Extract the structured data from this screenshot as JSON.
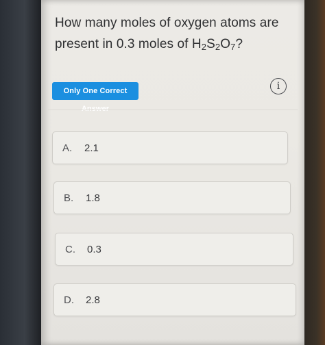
{
  "question": {
    "text_before": "How many moles of oxygen atoms are present in 0.3 moles of ",
    "formula": {
      "h": "H",
      "h_sub": "2",
      "s": "S",
      "s_sub": "2",
      "o": "O",
      "o_sub": "7"
    },
    "text_after": "?"
  },
  "badge": {
    "label": "Only One Correct Answer"
  },
  "info_icon": {
    "glyph": "i",
    "icon": "info-circle-icon"
  },
  "options": [
    {
      "letter": "A.",
      "value": "2.1"
    },
    {
      "letter": "B.",
      "value": "1.8"
    },
    {
      "letter": "C.",
      "value": "0.3"
    },
    {
      "letter": "D.",
      "value": "2.8"
    }
  ],
  "colors": {
    "badge_bg": "#1b8fe0",
    "screen_bg": "#ebe9e4",
    "text": "#2e2f31"
  }
}
